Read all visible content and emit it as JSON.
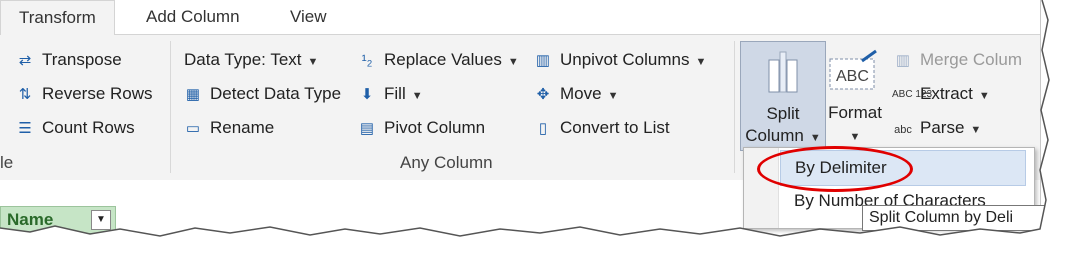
{
  "tabs": [
    {
      "label": "Transform"
    },
    {
      "label": "Add Column"
    },
    {
      "label": "View"
    }
  ],
  "table_group": {
    "items": [
      {
        "label": "Transpose",
        "icon": "transpose-icon"
      },
      {
        "label": "Reverse Rows",
        "icon": "reverse-rows-icon"
      },
      {
        "label": "Count Rows",
        "icon": "count-rows-icon"
      }
    ],
    "label_fragment": "le"
  },
  "any_column_group": {
    "col1": [
      {
        "label": "Data Type: Text",
        "icon": ""
      },
      {
        "label": "Detect Data Type",
        "icon": "detect-data-type-icon"
      },
      {
        "label": "Rename",
        "icon": "rename-icon"
      }
    ],
    "col2": [
      {
        "label": "Replace Values",
        "icon": "replace-values-icon"
      },
      {
        "label": "Fill",
        "icon": "fill-down-icon"
      },
      {
        "label": "Pivot Column",
        "icon": "pivot-column-icon"
      }
    ],
    "col3": [
      {
        "label": "Unpivot Columns",
        "icon": "unpivot-columns-icon"
      },
      {
        "label": "Move",
        "icon": "move-icon"
      },
      {
        "label": "Convert to List",
        "icon": "convert-to-list-icon"
      }
    ],
    "group_label": "Any Column"
  },
  "text_column_group": {
    "split_column": {
      "line1": "Split",
      "line2": "Column"
    },
    "format": {
      "label": "Format",
      "art_text": "ABC"
    },
    "items": [
      {
        "label": "Merge Colum",
        "icon": "merge-columns-icon",
        "disabled": true
      },
      {
        "label": "Extract",
        "icon": "extract-icon",
        "art": "ABC 123"
      },
      {
        "label": "Parse",
        "icon": "parse-icon",
        "art": "abc"
      }
    ]
  },
  "column_header": {
    "label": "Name"
  },
  "split_menu": {
    "items": [
      {
        "label": "By Delimiter"
      },
      {
        "label": "By Number of Characters"
      }
    ]
  },
  "tooltip": {
    "text": "Split Column by Deli"
  },
  "colors": {
    "highlight_circle": "#e00000",
    "selected_button": "#cfd8e6",
    "column_header": "#c6e5c6"
  }
}
